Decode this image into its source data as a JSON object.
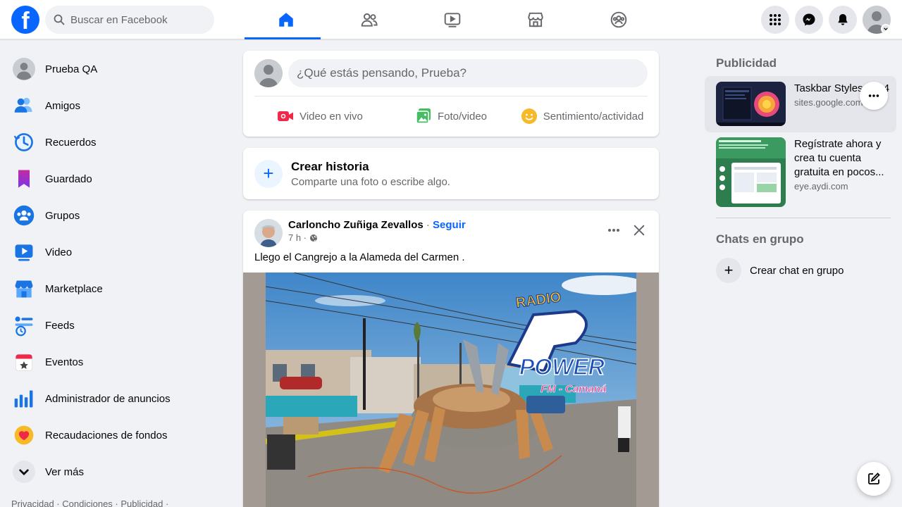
{
  "header": {
    "logo": "f",
    "search_placeholder": "Buscar en Facebook",
    "nav_tabs": [
      "home-icon",
      "friends-icon",
      "watch-icon",
      "marketplace-icon",
      "groups-icon"
    ],
    "right_icons": [
      "menu-grid-icon",
      "messenger-icon",
      "notifications-icon",
      "account-icon"
    ],
    "accent": "#0866ff"
  },
  "sidebar": {
    "items": [
      {
        "label": "Prueba QA",
        "icon": "profile-avatar"
      },
      {
        "label": "Amigos",
        "icon": "friends-icon"
      },
      {
        "label": "Recuerdos",
        "icon": "memories-icon"
      },
      {
        "label": "Guardado",
        "icon": "saved-icon"
      },
      {
        "label": "Grupos",
        "icon": "groups-icon"
      },
      {
        "label": "Video",
        "icon": "video-icon"
      },
      {
        "label": "Marketplace",
        "icon": "marketplace-icon"
      },
      {
        "label": "Feeds",
        "icon": "feeds-icon"
      },
      {
        "label": "Eventos",
        "icon": "events-icon"
      },
      {
        "label": "Administrador de anuncios",
        "icon": "ads-manager-icon"
      },
      {
        "label": "Recaudaciones de fondos",
        "icon": "fundraisers-icon"
      },
      {
        "label": "Ver más",
        "icon": "chevron-down-icon"
      }
    ],
    "footer": "Privacidad · Condiciones · Publicidad ·"
  },
  "composer": {
    "placeholder": "¿Qué estás pensando, Prueba?",
    "actions": [
      {
        "label": "Video en vivo",
        "color": "#f02849"
      },
      {
        "label": "Foto/video",
        "color": "#45bd62"
      },
      {
        "label": "Sentimiento/actividad",
        "color": "#f7b928"
      }
    ]
  },
  "story": {
    "title": "Crear historia",
    "subtitle": "Comparte una foto o escribe algo."
  },
  "post": {
    "author": "Carloncho Zuñiga Zevallos",
    "separator": "·",
    "follow": "Seguir",
    "time": "7 h ·",
    "text": "Llego el Cangrejo a la Alameda del Carmen .",
    "image_logo": {
      "top": "RADIO",
      "main": "POWER",
      "sub": "FM - Camaná"
    }
  },
  "right": {
    "ads_heading": "Publicidad",
    "ads": [
      {
        "title": "Taskbar Styles 2024",
        "source": "sites.google.com"
      },
      {
        "title": "Regístrate ahora y crea tu cuenta gratuita en pocos...",
        "source": "eye.aydi.com"
      }
    ],
    "chats_heading": "Chats en grupo",
    "create_chat": "Crear chat en grupo"
  }
}
